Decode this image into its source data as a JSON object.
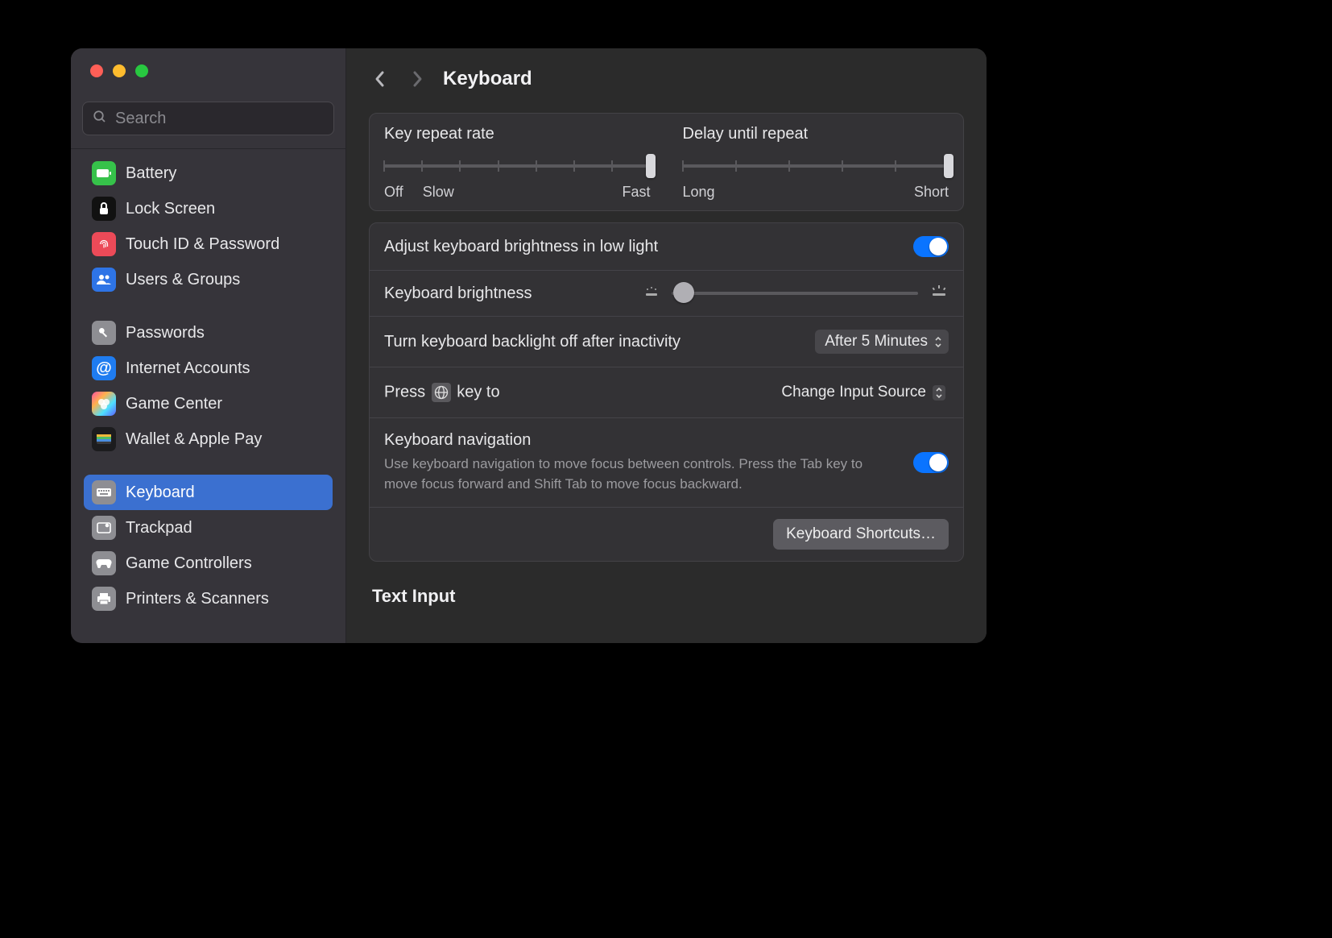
{
  "search": {
    "placeholder": "Search"
  },
  "header": {
    "title": "Keyboard"
  },
  "sidebar": {
    "groups": [
      {
        "items": [
          {
            "label": "Battery",
            "icon": "battery",
            "bg": "#36c24a"
          },
          {
            "label": "Lock Screen",
            "icon": "lock",
            "bg": "#111"
          },
          {
            "label": "Touch ID & Password",
            "icon": "fingerprint",
            "bg": "#ec4a58"
          },
          {
            "label": "Users & Groups",
            "icon": "users",
            "bg": "#2e74e6"
          }
        ]
      },
      {
        "items": [
          {
            "label": "Passwords",
            "icon": "key",
            "bg": "#8e8e93"
          },
          {
            "label": "Internet Accounts",
            "icon": "at",
            "bg": "#1f7cf0"
          },
          {
            "label": "Game Center",
            "icon": "gamecenter",
            "bg": "grad"
          },
          {
            "label": "Wallet & Apple Pay",
            "icon": "wallet",
            "bg": "#1c1c1e"
          }
        ]
      },
      {
        "items": [
          {
            "label": "Keyboard",
            "icon": "keyboard",
            "bg": "#8e8e93",
            "selected": true
          },
          {
            "label": "Trackpad",
            "icon": "trackpad",
            "bg": "#8e8e93"
          },
          {
            "label": "Game Controllers",
            "icon": "controller",
            "bg": "#8e8e93"
          },
          {
            "label": "Printers & Scanners",
            "icon": "printer",
            "bg": "#8e8e93"
          }
        ]
      }
    ]
  },
  "sliders": {
    "repeat": {
      "title": "Key repeat rate",
      "left": "Off",
      "mid": "Slow",
      "right": "Fast",
      "value": 7,
      "max": 7
    },
    "delay": {
      "title": "Delay until repeat",
      "left": "Long",
      "right": "Short",
      "value": 5,
      "max": 5
    }
  },
  "brightness": {
    "auto_label": "Adjust keyboard brightness in low light",
    "auto_on": true,
    "slider_label": "Keyboard brightness",
    "slider_value": 0.05,
    "backlight_label": "Turn keyboard backlight off after inactivity",
    "backlight_value": "After 5 Minutes",
    "globe_label_pre": "Press",
    "globe_label_post": "key to",
    "globe_value": "Change Input Source"
  },
  "nav": {
    "label": "Keyboard navigation",
    "desc": "Use keyboard navigation to move focus between controls. Press the Tab key to move focus forward and Shift Tab to move focus backward.",
    "on": true,
    "shortcuts_btn": "Keyboard Shortcuts…"
  },
  "text_input_heading": "Text Input"
}
